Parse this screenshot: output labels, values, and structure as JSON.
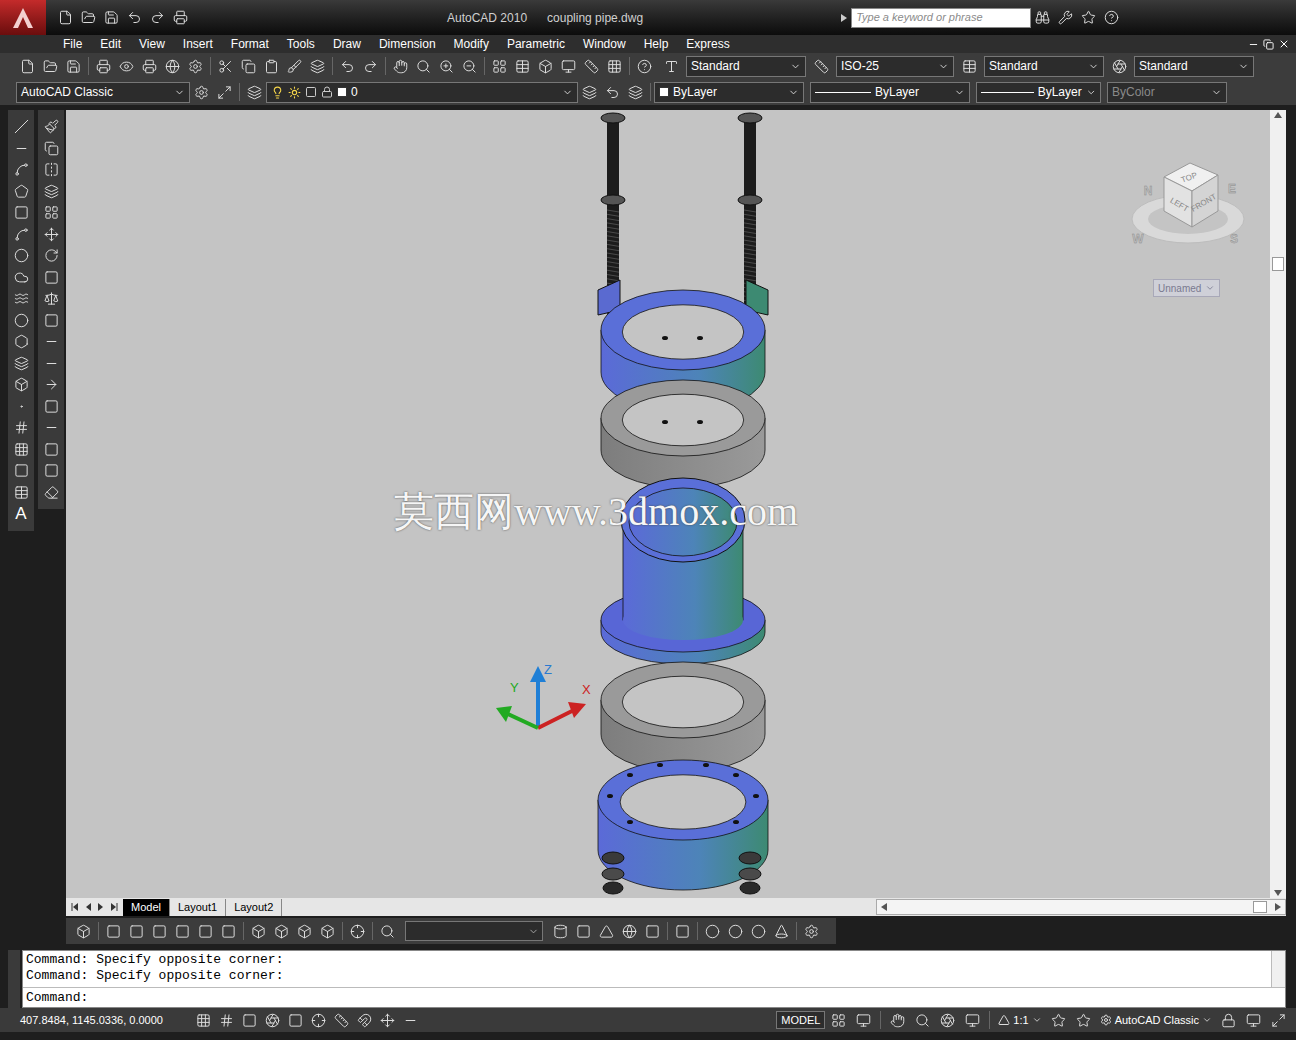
{
  "title_bar": {
    "app": "AutoCAD 2010",
    "file": "coupling pipe.dwg",
    "search_placeholder": "Type a keyword or phrase"
  },
  "menu": [
    "File",
    "Edit",
    "View",
    "Insert",
    "Format",
    "Tools",
    "Draw",
    "Dimension",
    "Modify",
    "Parametric",
    "Window",
    "Help",
    "Express"
  ],
  "styles_toolbar": [
    {
      "value": "Standard"
    },
    {
      "value": "ISO-25"
    },
    {
      "value": "Standard"
    },
    {
      "value": "Standard"
    }
  ],
  "workspace": "AutoCAD Classic",
  "layer": "0",
  "properties": [
    {
      "value": "ByLayer",
      "disabled": false
    },
    {
      "value": "ByLayer",
      "disabled": false
    },
    {
      "value": "ByLayer",
      "disabled": false
    },
    {
      "value": "ByColor",
      "disabled": true
    }
  ],
  "viewcube": {
    "top": "TOP",
    "left": "LEFT",
    "front": "FRONT",
    "compass": [
      "N",
      "E",
      "S",
      "W"
    ]
  },
  "view_name": "Unnamed",
  "ucs": {
    "x": "X",
    "y": "Y",
    "z": "Z"
  },
  "watermark": "莫西网www.3dmox.com",
  "text_tool": "A",
  "layout_tabs": [
    {
      "label": "Model",
      "selected": true
    },
    {
      "label": "Layout1",
      "selected": false
    },
    {
      "label": "Layout2",
      "selected": false
    }
  ],
  "command_history": [
    "Command: Specify opposite corner:",
    "Command: Specify opposite corner:"
  ],
  "command_prompt": "Command:",
  "status": {
    "coords": "407.8484, 1145.0336, 0.0000",
    "model": "MODEL",
    "scale": "1:1",
    "workspace": "AutoCAD Classic"
  }
}
